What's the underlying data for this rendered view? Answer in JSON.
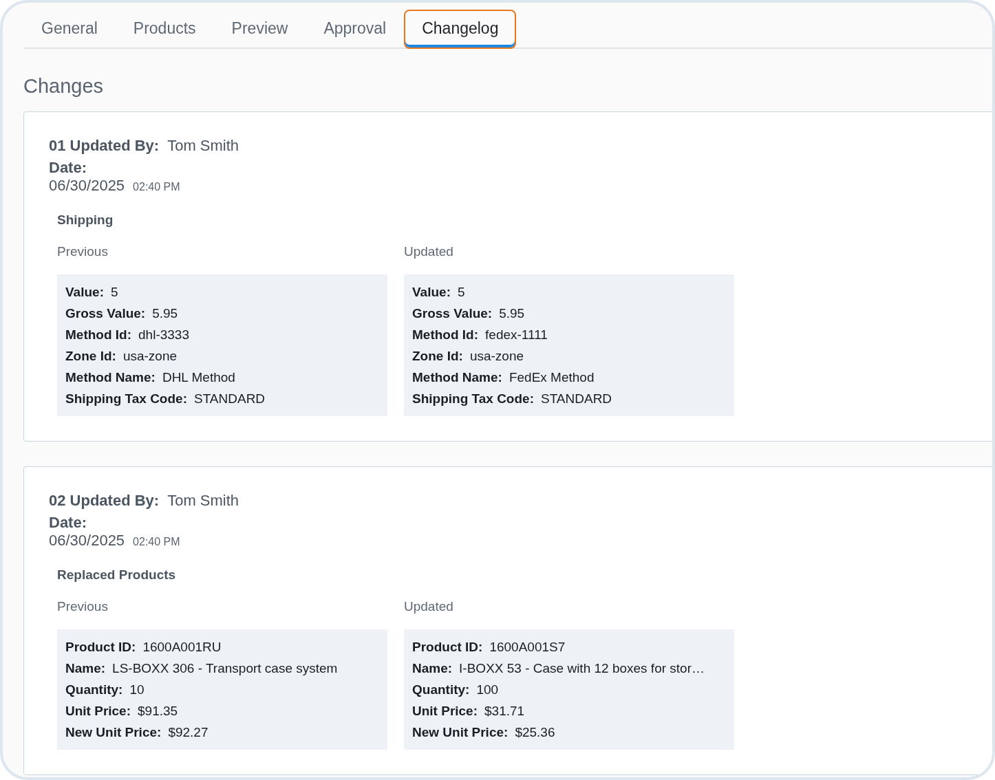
{
  "tabs": [
    {
      "label": "General",
      "selected": false,
      "focused": false
    },
    {
      "label": "Products",
      "selected": false,
      "focused": false
    },
    {
      "label": "Preview",
      "selected": false,
      "focused": false
    },
    {
      "label": "Approval",
      "selected": false,
      "focused": false
    },
    {
      "label": "Changelog",
      "selected": true,
      "focused": true
    }
  ],
  "heading": "Changes",
  "changes": [
    {
      "number": "01",
      "updated_by_label": "Updated By:",
      "updated_by": "Tom Smith",
      "date_label": "Date:",
      "date": "06/30/2025",
      "time": "02:40 PM",
      "section": "Shipping",
      "previous": {
        "title": "Previous",
        "fields": [
          {
            "label": "Value:",
            "value": "5"
          },
          {
            "label": "Gross Value:",
            "value": "5.95"
          },
          {
            "label": "Method Id:",
            "value": "dhl-3333"
          },
          {
            "label": "Zone Id:",
            "value": "usa-zone"
          },
          {
            "label": "Method Name:",
            "value": "DHL Method"
          },
          {
            "label": "Shipping Tax Code:",
            "value": "STANDARD"
          }
        ]
      },
      "updated": {
        "title": "Updated",
        "fields": [
          {
            "label": "Value:",
            "value": "5"
          },
          {
            "label": "Gross Value:",
            "value": "5.95"
          },
          {
            "label": "Method Id:",
            "value": "fedex-1111"
          },
          {
            "label": "Zone Id:",
            "value": "usa-zone"
          },
          {
            "label": "Method Name:",
            "value": "FedEx Method"
          },
          {
            "label": "Shipping Tax Code:",
            "value": "STANDARD"
          }
        ]
      }
    },
    {
      "number": "02",
      "updated_by_label": "Updated By:",
      "updated_by": "Tom Smith",
      "date_label": "Date:",
      "date": "06/30/2025",
      "time": "02:40 PM",
      "section": "Replaced Products",
      "previous": {
        "title": "Previous",
        "fields": [
          {
            "label": "Product ID:",
            "value": "1600A001RU"
          },
          {
            "label": "Name:",
            "value": "LS-BOXX 306 - Transport case system"
          },
          {
            "label": "Quantity:",
            "value": "10"
          },
          {
            "label": "Unit Price:",
            "value": "$91.35"
          },
          {
            "label": "New Unit Price:",
            "value": "$92.27"
          }
        ]
      },
      "updated": {
        "title": "Updated",
        "fields": [
          {
            "label": "Product ID:",
            "value": "1600A001S7"
          },
          {
            "label": "Name:",
            "value": "I-BOXX 53 - Case with 12 boxes for stor…"
          },
          {
            "label": "Quantity:",
            "value": "100"
          },
          {
            "label": "Unit Price:",
            "value": "$31.71"
          },
          {
            "label": "New Unit Price:",
            "value": "$25.36"
          }
        ]
      }
    }
  ]
}
